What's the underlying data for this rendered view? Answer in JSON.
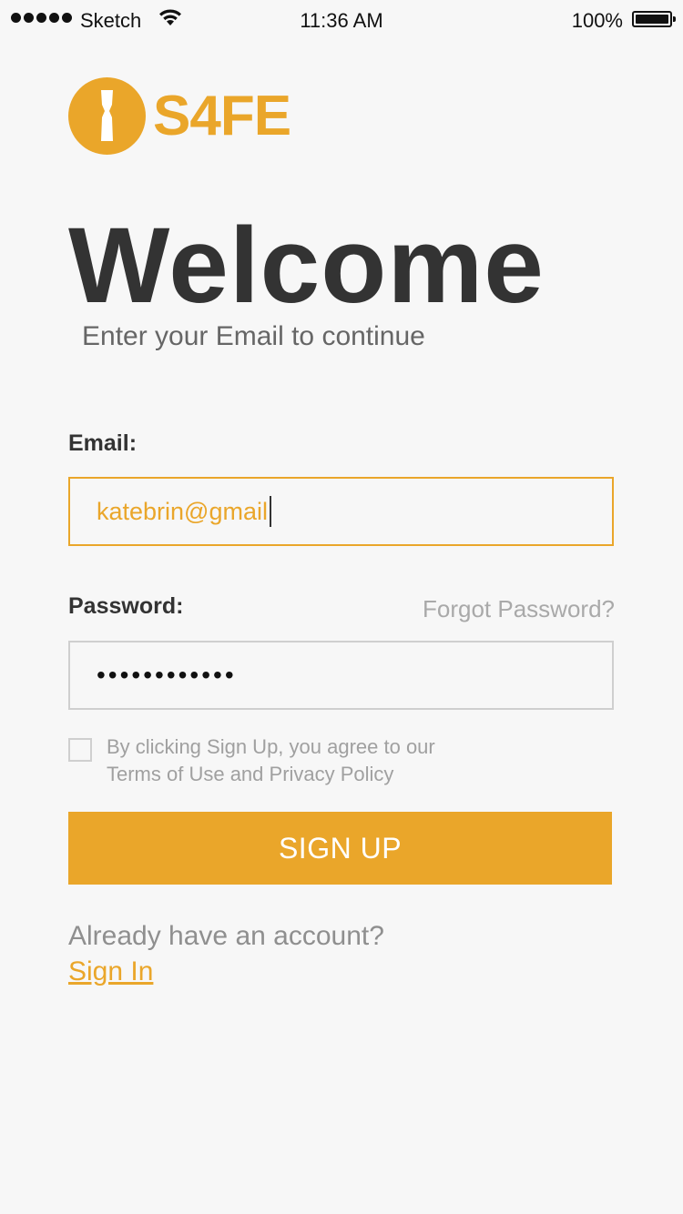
{
  "status_bar": {
    "carrier": "Sketch",
    "time": "11:36 AM",
    "battery": "100%"
  },
  "logo": {
    "text": "S4FE",
    "color": "#eaa62a"
  },
  "welcome": {
    "title": "Welcome",
    "subtitle": "Enter your Email to continue"
  },
  "form": {
    "email_label": "Email:",
    "email_value": "katebrin@gmail",
    "password_label": "Password:",
    "password_value": "••••••••••••",
    "forgot_label": "Forgot Password?",
    "agree_line1": "By clicking Sign Up, you agree to our",
    "agree_line2": "Terms of Use and Privacy Policy",
    "agree_checked": false
  },
  "signup_button": {
    "label": "SIGN UP",
    "color": "#eaa62a"
  },
  "footer": {
    "prompt": "Already have an account?",
    "signin_label": "Sign In"
  }
}
